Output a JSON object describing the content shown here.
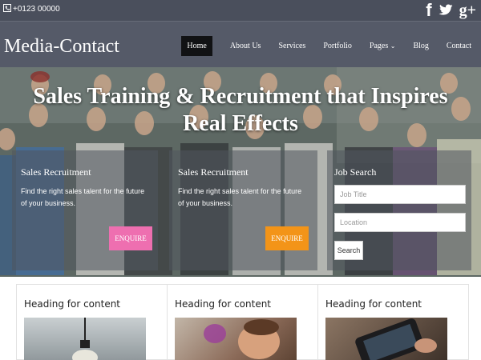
{
  "topbar": {
    "phone": "+0123 00000",
    "phone_icon": "phone-icon",
    "social": [
      {
        "name": "facebook-icon",
        "glyph": "f"
      },
      {
        "name": "twitter-icon",
        "glyph": ""
      },
      {
        "name": "google-plus-icon",
        "glyph": "g+"
      }
    ]
  },
  "nav": {
    "brand": "Media-Contact",
    "items": [
      {
        "label": "Home",
        "active": true
      },
      {
        "label": "About Us"
      },
      {
        "label": "Services"
      },
      {
        "label": "Portfolio"
      },
      {
        "label": "Pages"
      },
      {
        "label": "Blog"
      },
      {
        "label": "Contact"
      }
    ],
    "pages_chevron": "chevron-down-icon"
  },
  "hero": {
    "title": "Sales Training & Recruitment that Inspires Real Effects",
    "panels": [
      {
        "heading": "Sales Recruitment",
        "text": "Find the right sales talent for the future of your business.",
        "button": "ENQUIRE",
        "button_color": "#ee6fb0"
      },
      {
        "heading": "Sales Recruitment",
        "text": "Find the right sales talent for the future of your business.",
        "button": "ENQUIRE",
        "button_color": "#f39418"
      }
    ],
    "job_search": {
      "heading": "Job Search",
      "job_title_placeholder": "Job Title",
      "location_placeholder": "Location",
      "button": "Search"
    }
  },
  "content": {
    "columns": [
      {
        "heading": "Heading for content"
      },
      {
        "heading": "Heading for content"
      },
      {
        "heading": "Heading for content"
      }
    ]
  },
  "colors": {
    "topbar_bg": "#4a4f5c",
    "nav_bg": "#555a68",
    "active_nav": "#111214",
    "enquire_pink": "#ee6fb0",
    "enquire_orange": "#f39418"
  }
}
